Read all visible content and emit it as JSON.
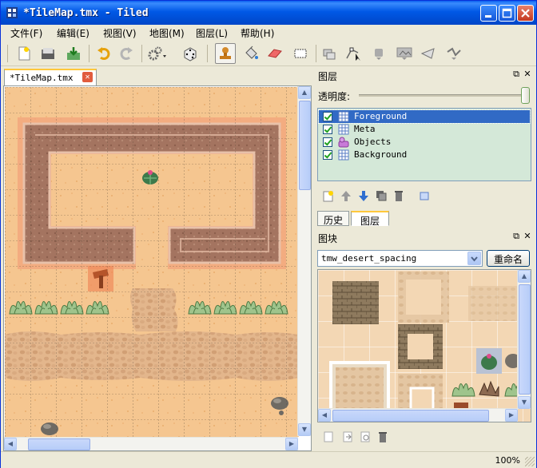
{
  "window": {
    "title": "*TileMap.tmx - Tiled"
  },
  "menu": [
    "文件(F)",
    "编辑(E)",
    "视图(V)",
    "地图(M)",
    "图层(L)",
    "帮助(H)"
  ],
  "toolbar": {
    "icons": [
      "new-file-icon",
      "open-folder-icon",
      "save-icon",
      "undo-icon",
      "redo-icon",
      "settings-gears-icon",
      "random-dice-icon",
      "stamp-brush-icon",
      "bucket-fill-icon",
      "eraser-icon",
      "rect-select-icon",
      "select-objects-icon",
      "edit-polygons-icon",
      "insert-rectangle-icon",
      "insert-image-icon",
      "insert-polygon-icon",
      "insert-polyline-icon"
    ]
  },
  "document_tab": {
    "label": "*TileMap.tmx"
  },
  "layers_panel": {
    "title": "图层",
    "opacity_label": "透明度:",
    "opacity_percent": 100,
    "layers": [
      {
        "name": "Foreground",
        "visible": true,
        "kind": "tile",
        "selected": true
      },
      {
        "name": "Meta",
        "visible": true,
        "kind": "tile",
        "selected": false
      },
      {
        "name": "Objects",
        "visible": true,
        "kind": "object",
        "selected": false
      },
      {
        "name": "Background",
        "visible": true,
        "kind": "tile",
        "selected": false
      }
    ]
  },
  "bottom_tabs": [
    "历史",
    "图层"
  ],
  "tileset_panel": {
    "title": "图块",
    "tileset_name": "tmw_desert_spacing",
    "rename_label": "重命名"
  },
  "status": {
    "zoom": "100%"
  },
  "colors": {
    "titlebar": "#0058e6",
    "selection": "#316ac5",
    "layer_bg": "#d4e8d8",
    "sand": "#f4c58e",
    "wall": "#a87662"
  }
}
